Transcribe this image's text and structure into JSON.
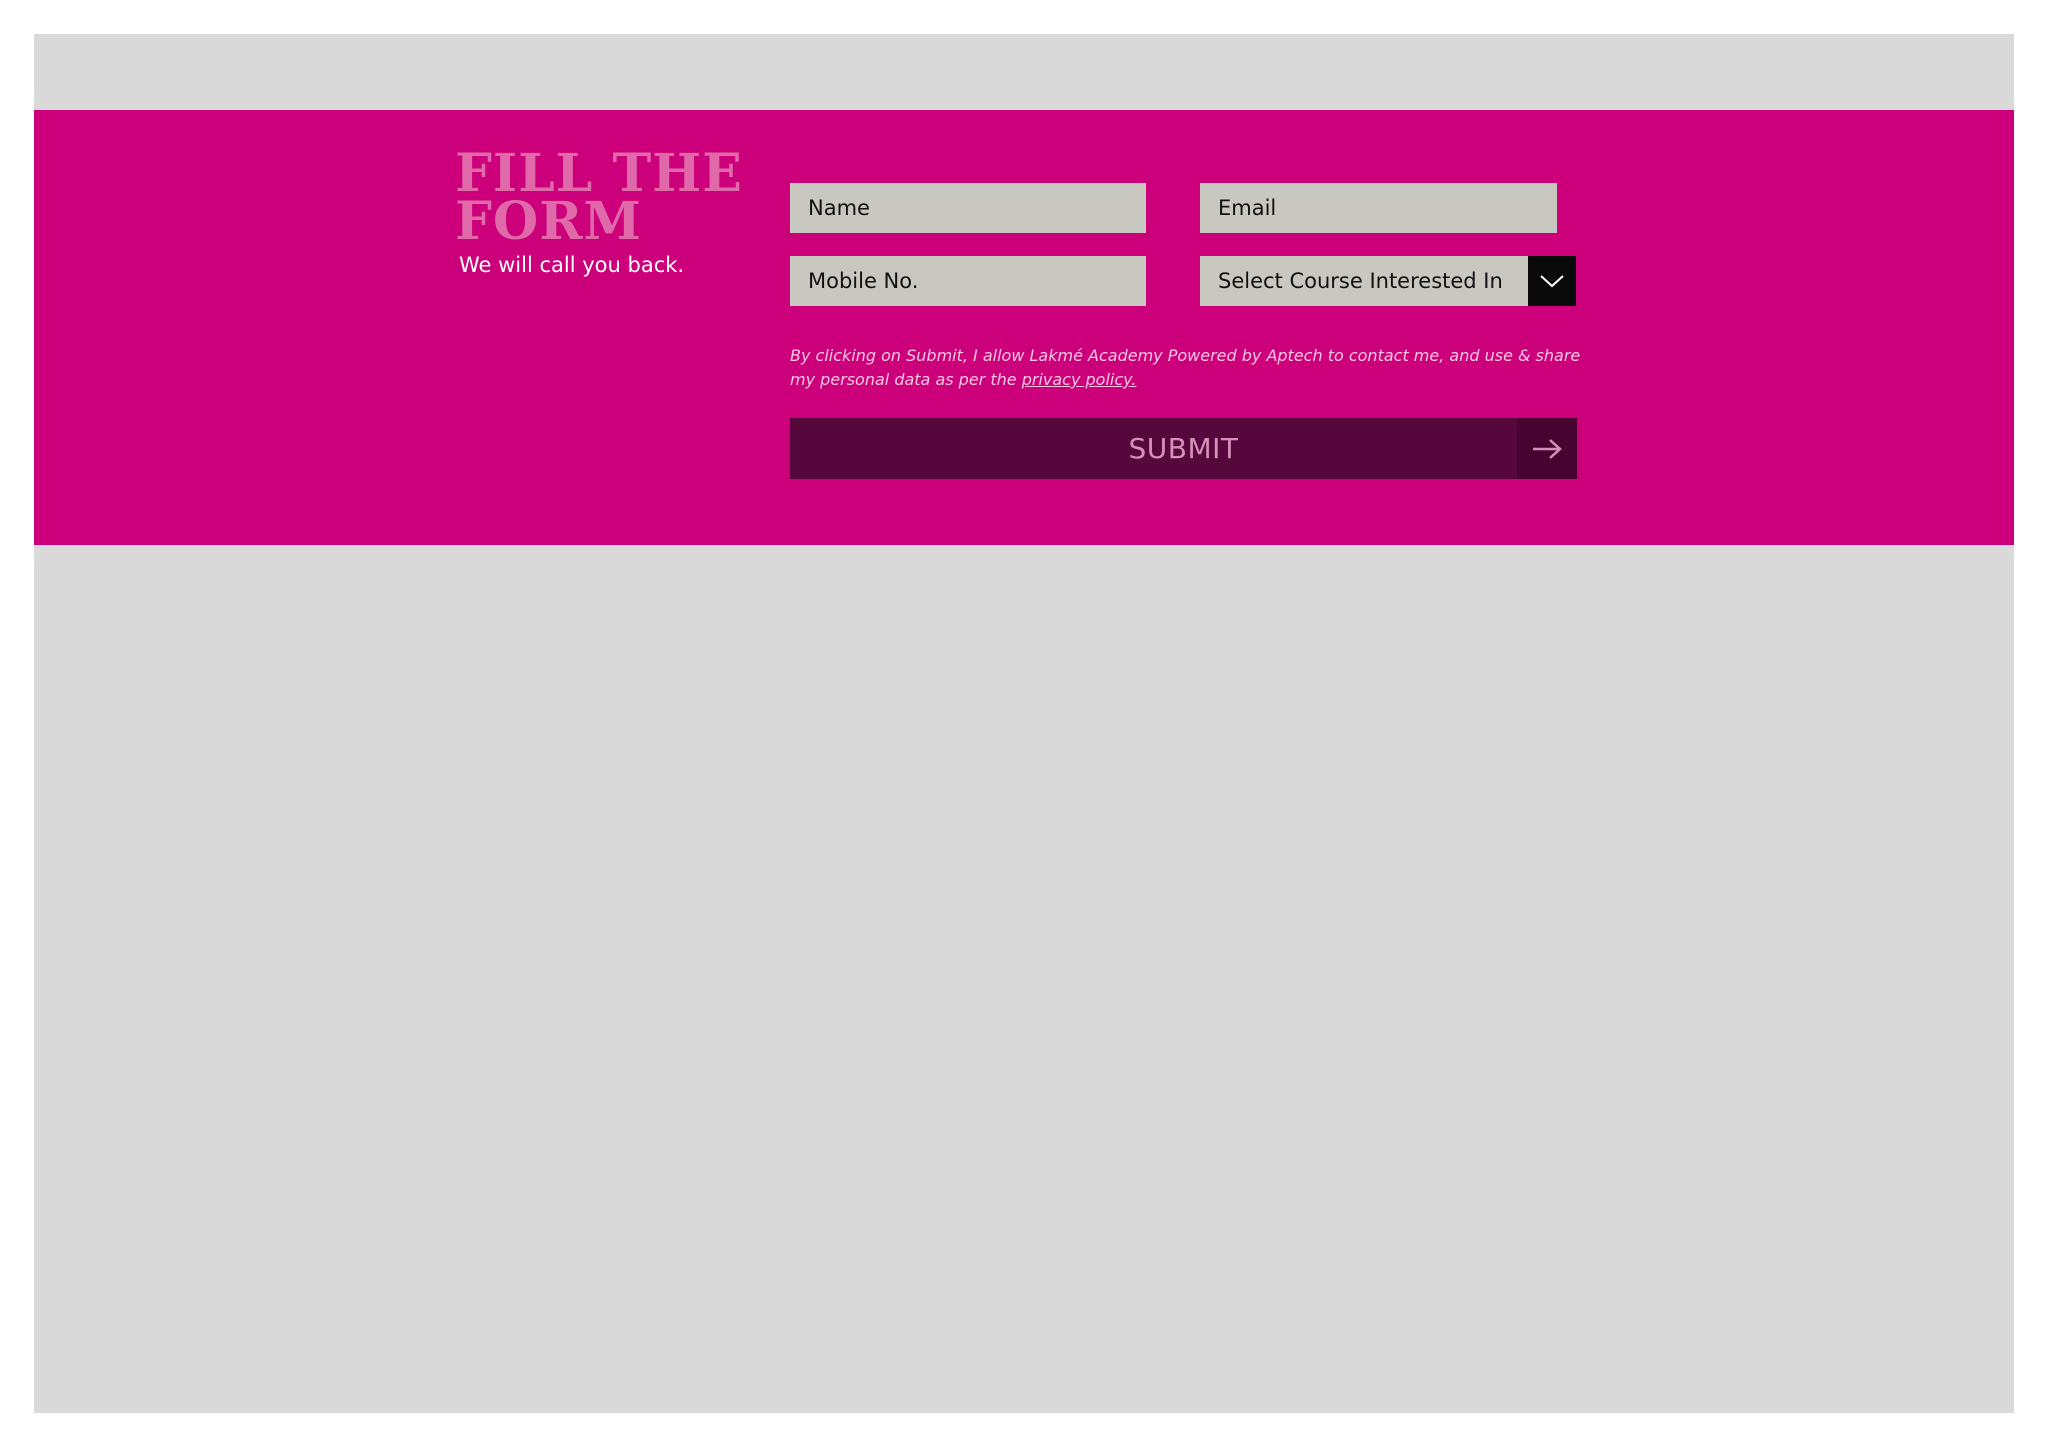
{
  "colors": {
    "band_background": "#cc007a",
    "page_background": "#d9d9d9",
    "heading": "#e06aa9",
    "input_background": "#c8c8c0",
    "submit_background": "#56083c",
    "submit_text": "#d490b9",
    "dropdown_arrow_background": "#0a0a0a"
  },
  "form_section": {
    "heading": "FILL THE FORM",
    "subheading": "We will call you back.",
    "fields": {
      "name_placeholder": "Name",
      "email_placeholder": "Email",
      "mobile_placeholder": "Mobile No.",
      "course_select_value": "Select Course Interested In"
    },
    "consent": {
      "text": "By clicking on Submit, I allow Lakmé Academy Powered by Aptech to contact me, and use & share my personal data as per the ",
      "link_label": "privacy policy."
    },
    "submit_label": "SUBMIT",
    "icons": {
      "dropdown": "chevron-down-icon",
      "submit": "arrow-right-icon"
    }
  }
}
